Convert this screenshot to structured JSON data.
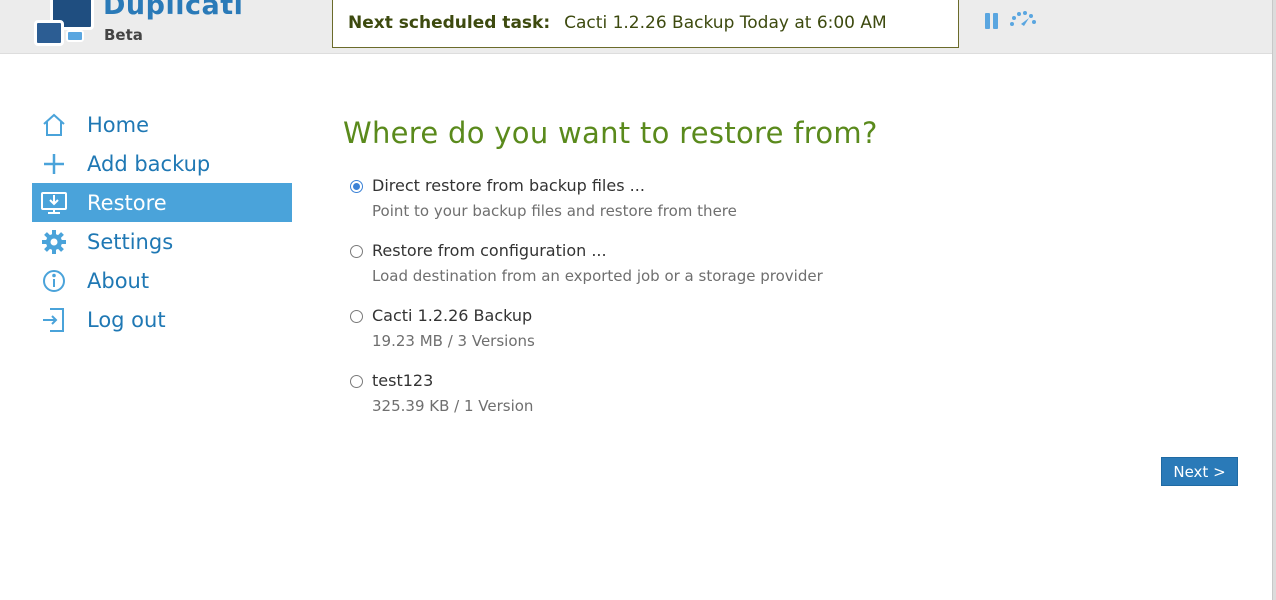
{
  "app": {
    "name": "Duplicati",
    "edition": "Beta"
  },
  "header": {
    "next_task_label": "Next scheduled task:",
    "next_task_value": "Cacti 1.2.26 Backup Today at 6:00 AM",
    "pause_icon": "pause-icon",
    "throttle_icon": "throttle-icon",
    "accent_color": "#5aa6e0"
  },
  "sidebar": {
    "items": [
      {
        "label": "Home",
        "icon": "home-icon",
        "active": false
      },
      {
        "label": "Add backup",
        "icon": "plus-icon",
        "active": false
      },
      {
        "label": "Restore",
        "icon": "restore-icon",
        "active": true
      },
      {
        "label": "Settings",
        "icon": "gear-icon",
        "active": false
      },
      {
        "label": "About",
        "icon": "info-icon",
        "active": false
      },
      {
        "label": "Log out",
        "icon": "logout-icon",
        "active": false
      }
    ],
    "active_color": "#4aa3da",
    "link_color": "#1f78b4"
  },
  "main": {
    "title": "Where do you want to restore from?",
    "title_color": "#5a8a1c",
    "options": [
      {
        "title": "Direct restore from backup files ...",
        "description": "Point to your backup files and restore from there",
        "selected": true
      },
      {
        "title": "Restore from configuration ...",
        "description": "Load destination from an exported job or a storage provider",
        "selected": false
      },
      {
        "title": "Cacti 1.2.26 Backup",
        "description": "19.23 MB / 3 Versions",
        "selected": false
      },
      {
        "title": "test123",
        "description": "325.39 KB / 1 Version",
        "selected": false
      }
    ],
    "next_label": "Next >"
  }
}
